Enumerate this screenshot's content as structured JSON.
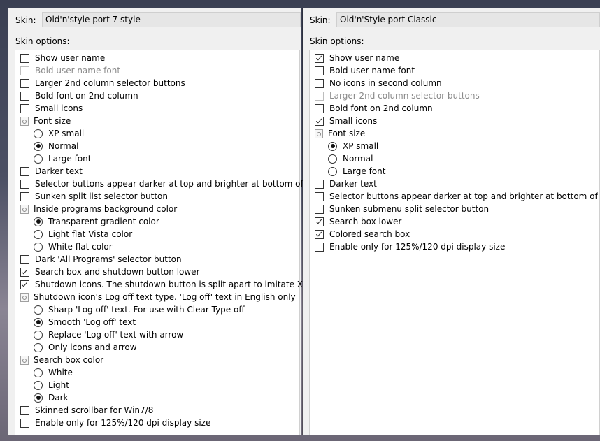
{
  "left": {
    "skin_label": "Skin:",
    "skin_value": "Old'n'style port 7 style",
    "options_label": "Skin options:",
    "items": [
      {
        "type": "checkbox",
        "level": 1,
        "checked": false,
        "disabled": false,
        "label": "Show user name"
      },
      {
        "type": "checkbox",
        "level": 1,
        "checked": false,
        "disabled": true,
        "label": "Bold user name font"
      },
      {
        "type": "checkbox",
        "level": 1,
        "checked": false,
        "disabled": false,
        "label": "Larger 2nd column selector buttons"
      },
      {
        "type": "checkbox",
        "level": 1,
        "checked": false,
        "disabled": false,
        "label": "Bold font on 2nd column"
      },
      {
        "type": "checkbox",
        "level": 1,
        "checked": false,
        "disabled": false,
        "label": "Small icons"
      },
      {
        "type": "group",
        "level": 1,
        "label": "Font size"
      },
      {
        "type": "radio",
        "level": 2,
        "checked": false,
        "label": "XP small"
      },
      {
        "type": "radio",
        "level": 2,
        "checked": true,
        "label": "Normal"
      },
      {
        "type": "radio",
        "level": 2,
        "checked": false,
        "label": "Large font"
      },
      {
        "type": "checkbox",
        "level": 1,
        "checked": false,
        "disabled": false,
        "label": "Darker text"
      },
      {
        "type": "checkbox",
        "level": 1,
        "checked": false,
        "disabled": false,
        "label": "Selector buttons appear darker at top and brighter at bottom of menu"
      },
      {
        "type": "checkbox",
        "level": 1,
        "checked": false,
        "disabled": false,
        "label": "Sunken split list selector button"
      },
      {
        "type": "group",
        "level": 1,
        "label": "Inside programs background color"
      },
      {
        "type": "radio",
        "level": 2,
        "checked": true,
        "label": "Transparent gradient color"
      },
      {
        "type": "radio",
        "level": 2,
        "checked": false,
        "label": "Light flat Vista color"
      },
      {
        "type": "radio",
        "level": 2,
        "checked": false,
        "label": "White flat color"
      },
      {
        "type": "checkbox",
        "level": 1,
        "checked": false,
        "disabled": false,
        "label": "Dark 'All Programs' selector button"
      },
      {
        "type": "checkbox",
        "level": 1,
        "checked": true,
        "disabled": false,
        "label": "Search box and shutdown button lower"
      },
      {
        "type": "checkbox",
        "level": 1,
        "checked": true,
        "disabled": false,
        "label": "Shutdown icons. The shutdown button is split apart to imitate XP look"
      },
      {
        "type": "group",
        "level": 1,
        "label": "Shutdown icon's Log off text type. 'Log off' text in English only"
      },
      {
        "type": "radio",
        "level": 2,
        "checked": false,
        "label": "Sharp  'Log off'  text. For use with Clear Type off"
      },
      {
        "type": "radio",
        "level": 2,
        "checked": true,
        "label": "Smooth 'Log off'  text"
      },
      {
        "type": "radio",
        "level": 2,
        "checked": false,
        "label": "Replace  'Log off'  text with arrow"
      },
      {
        "type": "radio",
        "level": 2,
        "checked": false,
        "label": "Only icons and arrow"
      },
      {
        "type": "group",
        "level": 1,
        "label": "Search box color"
      },
      {
        "type": "radio",
        "level": 2,
        "checked": false,
        "label": "White"
      },
      {
        "type": "radio",
        "level": 2,
        "checked": false,
        "label": "Light"
      },
      {
        "type": "radio",
        "level": 2,
        "checked": true,
        "label": "Dark"
      },
      {
        "type": "checkbox",
        "level": 1,
        "checked": false,
        "disabled": false,
        "label": "Skinned scrollbar for Win7/8"
      },
      {
        "type": "checkbox",
        "level": 1,
        "checked": false,
        "disabled": false,
        "label": "Enable only for 125%/120 dpi display size"
      }
    ]
  },
  "right": {
    "skin_label": "Skin:",
    "skin_value": "Old'n'Style port Classic",
    "options_label": "Skin options:",
    "items": [
      {
        "type": "checkbox",
        "level": 1,
        "checked": true,
        "disabled": false,
        "label": "Show user name"
      },
      {
        "type": "checkbox",
        "level": 1,
        "checked": false,
        "disabled": false,
        "label": "Bold user name font"
      },
      {
        "type": "checkbox",
        "level": 1,
        "checked": false,
        "disabled": false,
        "label": "No icons in second column"
      },
      {
        "type": "checkbox",
        "level": 1,
        "checked": false,
        "disabled": true,
        "label": "Larger 2nd column selector buttons"
      },
      {
        "type": "checkbox",
        "level": 1,
        "checked": false,
        "disabled": false,
        "label": "Bold font on 2nd column"
      },
      {
        "type": "checkbox",
        "level": 1,
        "checked": true,
        "disabled": false,
        "label": "Small icons"
      },
      {
        "type": "group",
        "level": 1,
        "label": "Font size"
      },
      {
        "type": "radio",
        "level": 2,
        "checked": true,
        "label": "XP small"
      },
      {
        "type": "radio",
        "level": 2,
        "checked": false,
        "label": "Normal"
      },
      {
        "type": "radio",
        "level": 2,
        "checked": false,
        "label": "Large font"
      },
      {
        "type": "checkbox",
        "level": 1,
        "checked": false,
        "disabled": false,
        "label": "Darker text"
      },
      {
        "type": "checkbox",
        "level": 1,
        "checked": false,
        "disabled": false,
        "label": "Selector buttons appear darker at top and brighter at bottom of menu"
      },
      {
        "type": "checkbox",
        "level": 1,
        "checked": false,
        "disabled": false,
        "label": "Sunken submenu split selector button"
      },
      {
        "type": "checkbox",
        "level": 1,
        "checked": true,
        "disabled": false,
        "label": "Search box lower"
      },
      {
        "type": "checkbox",
        "level": 1,
        "checked": true,
        "disabled": false,
        "label": "Colored search box"
      },
      {
        "type": "checkbox",
        "level": 1,
        "checked": false,
        "disabled": false,
        "label": "Enable only for 125%/120 dpi display size"
      }
    ]
  }
}
